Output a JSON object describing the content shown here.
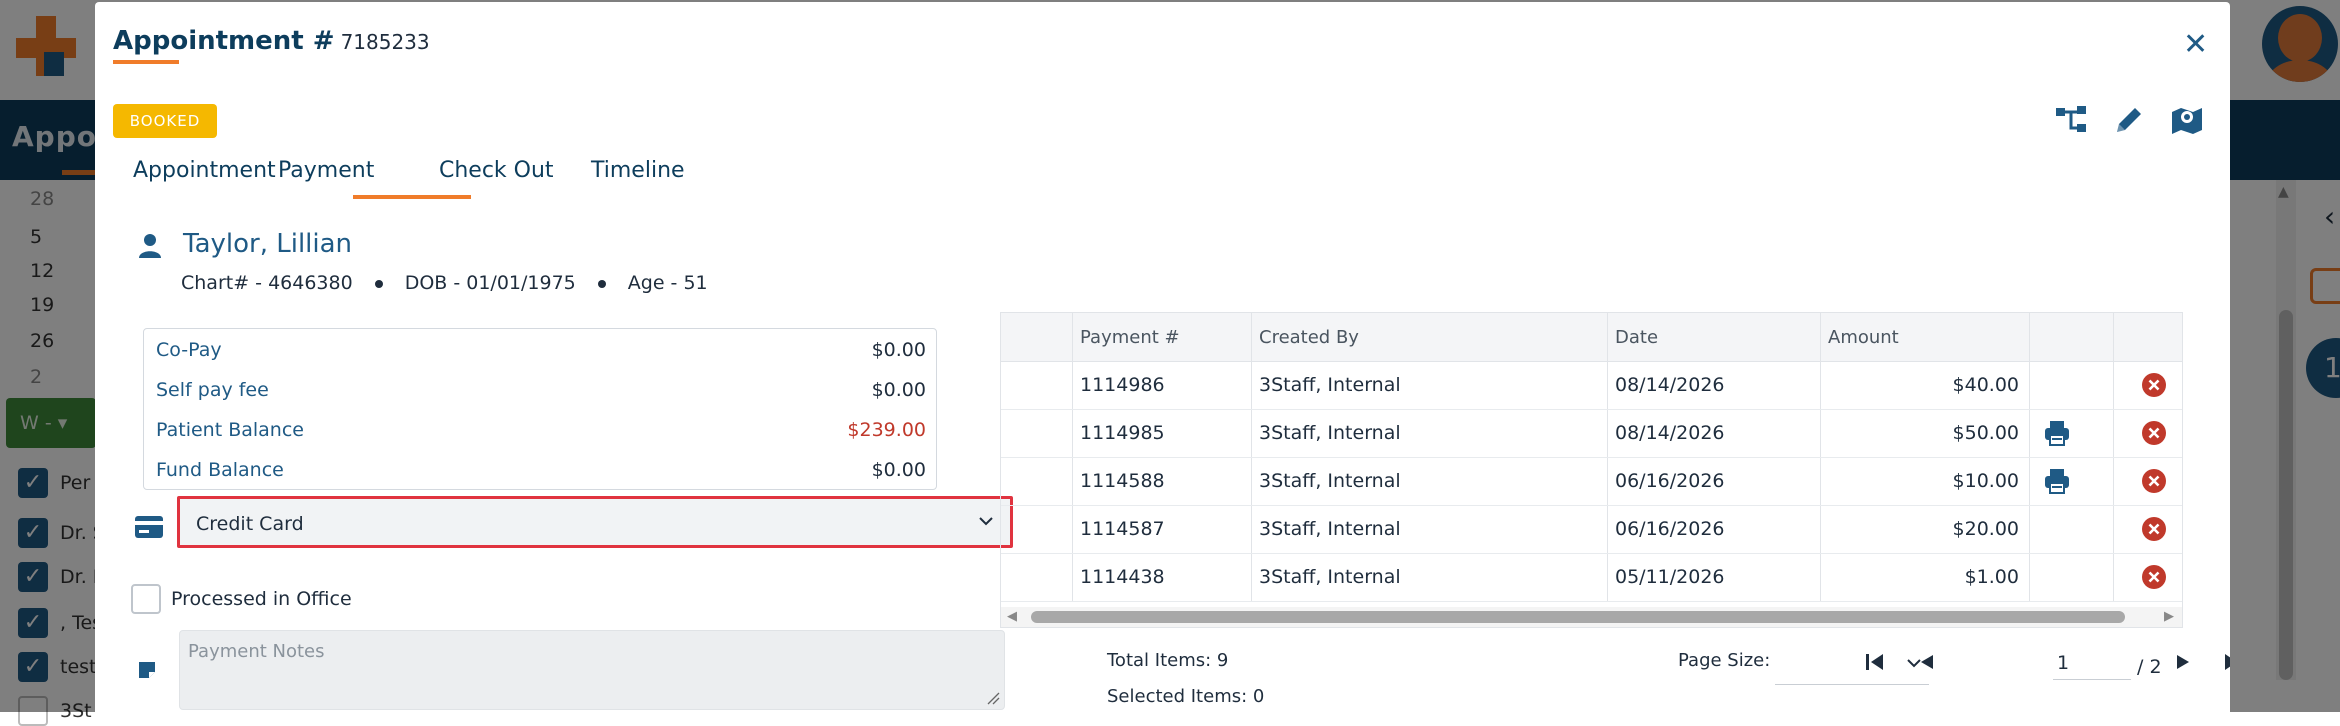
{
  "background": {
    "bar_title": "Appoi",
    "dates": [
      "28",
      "5",
      "12",
      "19",
      "26",
      "2"
    ],
    "filter_label": "W -",
    "checkbox_labels": [
      "Per",
      "Dr. S",
      "Dr. I",
      ", Tes",
      "test",
      "3St"
    ],
    "badge_count": "1"
  },
  "modal": {
    "title": "Appointment #",
    "appointment_number": "7185233",
    "status_badge": "BOOKED",
    "tabs": [
      {
        "label": "Appointment"
      },
      {
        "label": "Payment"
      },
      {
        "label": "Check Out"
      },
      {
        "label": "Timeline"
      }
    ],
    "active_tab": "Payment",
    "patient": {
      "name": "Taylor, Lillian",
      "chart": "Chart# - 4646380",
      "dob": "DOB - 01/01/1975",
      "age": "Age - 51"
    },
    "balances": [
      {
        "label": "Co-Pay",
        "value": "$0.00"
      },
      {
        "label": "Self pay fee",
        "value": "$0.00"
      },
      {
        "label": "Patient Balance",
        "value": "$239.00"
      },
      {
        "label": "Fund Balance",
        "value": "$0.00"
      }
    ],
    "payment_method": "Credit Card",
    "processed_in_office_label": "Processed in Office",
    "payment_notes_placeholder": "Payment Notes"
  },
  "payments_grid": {
    "columns": [
      "Payment #",
      "Created By",
      "Date",
      "Amount"
    ],
    "rows": [
      {
        "payment": "1114986",
        "created_by": "3Staff, Internal",
        "date": "08/14/2026",
        "amount": "$40.00",
        "printable": false
      },
      {
        "payment": "1114985",
        "created_by": "3Staff, Internal",
        "date": "08/14/2026",
        "amount": "$50.00",
        "printable": true
      },
      {
        "payment": "1114588",
        "created_by": "3Staff, Internal",
        "date": "06/16/2026",
        "amount": "$10.00",
        "printable": true
      },
      {
        "payment": "1114587",
        "created_by": "3Staff, Internal",
        "date": "06/16/2026",
        "amount": "$20.00",
        "printable": false
      },
      {
        "payment": "1114438",
        "created_by": "3Staff, Internal",
        "date": "05/11/2026",
        "amount": "$1.00",
        "printable": false
      }
    ],
    "total_items": "Total Items: 9",
    "selected_items": "Selected Items: 0",
    "page_size_label": "Page Size:",
    "page_size_value": "",
    "current_page": "1",
    "total_pages": "/ 2"
  },
  "colors": {
    "primary": "#1f5a85",
    "accent": "#f07c2a",
    "badge": "#f5b800",
    "danger": "#c0392b",
    "alert_border": "#e0333f"
  },
  "icons": {
    "close": "close-icon",
    "hierarchy": "hierarchy-icon",
    "edit": "pencil-icon",
    "map": "map-icon",
    "person": "person-icon",
    "card": "credit-card-icon",
    "note": "note-icon",
    "print": "printer-icon",
    "delete": "delete-circle-icon"
  }
}
